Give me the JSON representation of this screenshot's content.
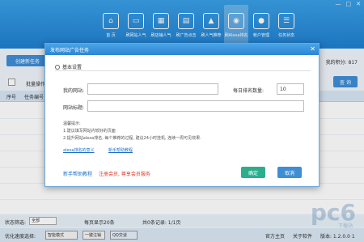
{
  "window": {
    "controls": [
      "—",
      "□",
      "✕"
    ]
  },
  "nav": [
    {
      "label": "首 页",
      "icon": "home-icon",
      "glyph": "⌂"
    },
    {
      "label": "刷网站人气",
      "icon": "monitor-icon",
      "glyph": "▭"
    },
    {
      "label": "刷店铺人气",
      "icon": "shop-icon",
      "glyph": "▦"
    },
    {
      "label": "刷广告点击",
      "icon": "ad-icon",
      "glyph": "▤"
    },
    {
      "label": "刷人气推荐",
      "icon": "chart-icon",
      "glyph": "▲"
    },
    {
      "label": "刷Alexa排名",
      "icon": "globe-icon",
      "glyph": "◉"
    },
    {
      "label": "帐户管理",
      "icon": "user-icon",
      "glyph": "●"
    },
    {
      "label": "任务状态",
      "icon": "list-icon",
      "glyph": "☰"
    }
  ],
  "toolbar": {
    "create_label": "创建新任务",
    "right_info": "我的积分: 817"
  },
  "filter": {
    "batch_label": "批量操作",
    "query_label": "查 询"
  },
  "table": {
    "headers": [
      "序号",
      "任务编号"
    ]
  },
  "status": {
    "filter_label": "状态筛选:",
    "filter_value": "全部",
    "page_size": "每页显示20条",
    "total": "共0条记录: 1/1页"
  },
  "bottom": {
    "speed_label": "优化速度选择:",
    "mode_value": "智能模式",
    "logout_label": "一键注销",
    "qq_label": "QQ交谈",
    "home_label": "官方主页",
    "about_label": "关于软件",
    "version": "版本: 1.2.0.0 1"
  },
  "watermark": {
    "main": "pc6",
    "sub": "下载站"
  },
  "dialog": {
    "title": "发布网站广告任务",
    "section": "基本设置",
    "url_label": "我的网站:",
    "url_value": "",
    "rank_label": "每日排名数量:",
    "rank_value": "10",
    "title_label": "网站标题:",
    "title_value": "",
    "hints": [
      "温馨提示:",
      "1.建议填写网站内较好的页面",
      "2.提升网站alexa排名, 每个推荐的过程, 建议24小时挂机, 连续一周可见效果."
    ],
    "link1": "alexa排名的意义",
    "link2": "新手帮助教程",
    "new_help": "新手帮助教程",
    "note": "注册会员, 尊享会员服务",
    "ok_label": "确定",
    "cancel_label": "取消"
  }
}
